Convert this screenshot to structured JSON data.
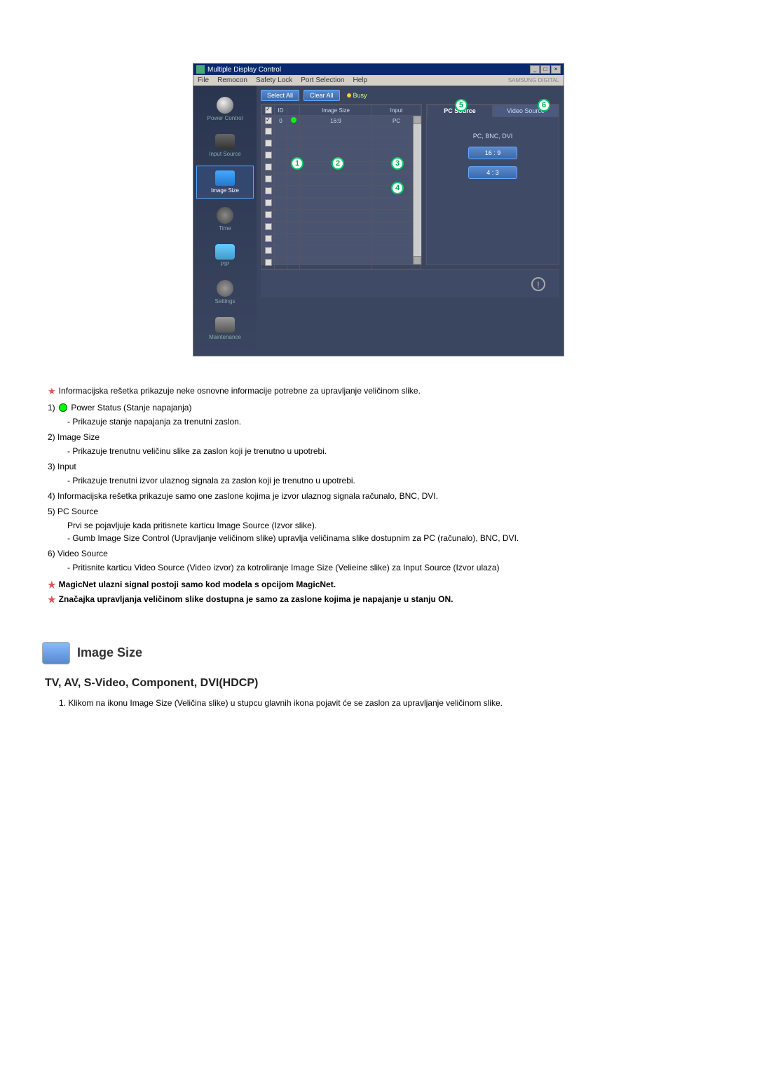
{
  "app": {
    "title": "Multiple Display Control",
    "brand": "SAMSUNG DIGITAL",
    "menubar": [
      "File",
      "Remocon",
      "Safety Lock",
      "Port Selection",
      "Help"
    ]
  },
  "toolbar": {
    "select_all": "Select All",
    "clear_all": "Clear All",
    "busy": "Busy"
  },
  "sidebar": {
    "items": [
      {
        "label": "Power Control"
      },
      {
        "label": "Input Source"
      },
      {
        "label": "Image Size"
      },
      {
        "label": "Time"
      },
      {
        "label": "PIP"
      },
      {
        "label": "Settings"
      },
      {
        "label": "Maintenance"
      }
    ]
  },
  "grid": {
    "headers": [
      "",
      "ID",
      "",
      "Image Size",
      "Input"
    ],
    "row": {
      "id": "0",
      "size": "16:9",
      "input": "PC"
    }
  },
  "right_panel": {
    "tabs": {
      "pc": "PC Source",
      "video": "Video Source"
    },
    "line1": "PC, BNC, DVI",
    "btn1": "16 : 9",
    "btn2": "4 : 3"
  },
  "callouts": {
    "c1": "1",
    "c2": "2",
    "c3": "3",
    "c4": "4",
    "c5": "5",
    "c6": "6"
  },
  "doc": {
    "intro": "Informacijska rešetka prikazuje neke osnovne informacije potrebne za upravljanje veličinom slike.",
    "items": [
      {
        "n": "1)",
        "title": "Power Status (Stanje napajanja)",
        "sub": "- Prikazuje stanje napajanja za trenutni zaslon.",
        "icon": true
      },
      {
        "n": "2)",
        "title": "Image Size",
        "sub": "- Prikazuje trenutnu veličinu slike za zaslon koji je trenutno u upotrebi."
      },
      {
        "n": "3)",
        "title": "Input",
        "sub": "- Prikazuje trenutni izvor ulaznog signala za zaslon koji je trenutno u upotrebi."
      },
      {
        "n": "4)",
        "title": "Informacijska rešetka prikazuje samo one zaslone kojima je izvor ulaznog signala računalo, BNC, DVI."
      },
      {
        "n": "5)",
        "title": "PC Source",
        "sub": "Prvi se pojavljuje kada pritisnete karticu Image Source (Izvor slike).",
        "sub2": "- Gumb Image Size Control (Upravljanje veličinom slike) upravlja veličinama slike dostupnim za PC (računalo), BNC, DVI."
      },
      {
        "n": "6)",
        "title": "Video Source",
        "sub": "- Pritisnite karticu Video Source (Video izvor) za kotroliranje Image Size (Velieine slike) za Input Source (Izvor ulaza)"
      }
    ],
    "note1": "MagicNet ulazni signal postoji samo kod modela s opcijom MagicNet.",
    "note2": "Značajka upravljanja veličinom slike dostupna je samo za zaslone kojima je napajanje u stanju ON.",
    "section_title": "Image Size",
    "subhead": "TV, AV, S-Video, Component, DVI(HDCP)",
    "ol1": "1. Klikom na ikonu Image Size (Veličina slike) u stupcu glavnih ikona pojavit će se zaslon za upravljanje veličinom slike."
  }
}
